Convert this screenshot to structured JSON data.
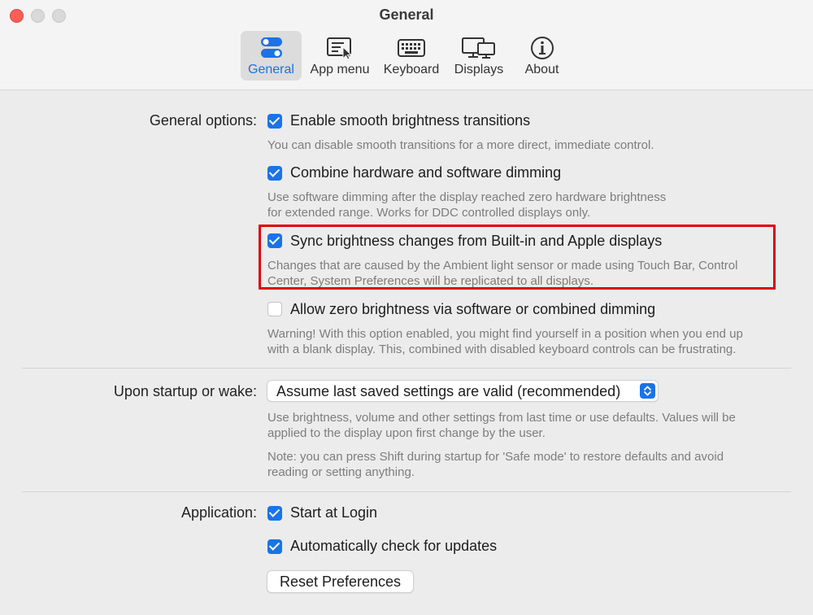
{
  "window": {
    "title": "General"
  },
  "toolbar": {
    "tabs": [
      {
        "label": "General",
        "icon": "toggle-switches-icon",
        "selected": true
      },
      {
        "label": "App menu",
        "icon": "menu-cursor-icon",
        "selected": false
      },
      {
        "label": "Keyboard",
        "icon": "keyboard-icon",
        "selected": false
      },
      {
        "label": "Displays",
        "icon": "displays-icon",
        "selected": false
      },
      {
        "label": "About",
        "icon": "info-icon",
        "selected": false
      }
    ]
  },
  "general_options": {
    "label": "General options:",
    "items": [
      {
        "label": "Enable smooth brightness transitions",
        "checked": true,
        "desc": [
          "You can disable smooth transitions for a more direct, immediate control."
        ]
      },
      {
        "label": "Combine hardware and software dimming",
        "checked": true,
        "desc": [
          "Use software dimming after the display reached zero hardware brightness",
          "for extended range. Works for DDC controlled displays only."
        ]
      },
      {
        "label": "Sync brightness changes from Built-in and Apple displays",
        "checked": true,
        "desc": [
          "Changes that are caused by the Ambient light sensor or made using Touch Bar, Control",
          "Center, System Preferences will be replicated to all displays."
        ]
      },
      {
        "label": "Allow zero brightness via software or combined dimming",
        "checked": false,
        "desc": [
          "Warning! With this option enabled, you might find yourself in a position when you end up",
          "with a blank display. This, combined with disabled keyboard controls can be frustrating."
        ]
      }
    ]
  },
  "startup": {
    "label": "Upon startup or wake:",
    "selected": "Assume last saved settings are valid (recommended)",
    "desc1": [
      "Use brightness, volume and other settings from last time or use defaults. Values will be",
      "applied to the display upon first change by the user."
    ],
    "desc2": [
      "Note: you can press Shift during startup for 'Safe mode' to restore defaults and avoid",
      "reading or setting anything."
    ]
  },
  "application": {
    "label": "Application:",
    "start_at_login": {
      "label": "Start at Login",
      "checked": true
    },
    "auto_update": {
      "label": "Automatically check for updates",
      "checked": true
    },
    "reset_button": "Reset Preferences"
  },
  "colors": {
    "accent": "#1a73e8",
    "highlight": "#e00000",
    "close": "#ff5f57"
  }
}
